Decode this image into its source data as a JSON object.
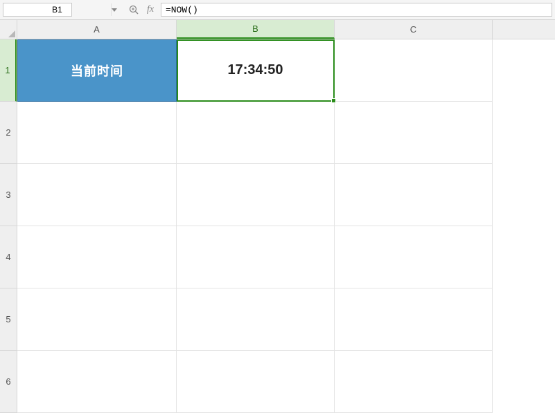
{
  "nameBox": {
    "value": "B1"
  },
  "formulaBar": {
    "value": "=NOW()"
  },
  "fxLabel": "fx",
  "columns": {
    "A": {
      "label": "A"
    },
    "B": {
      "label": "B"
    },
    "C": {
      "label": "C"
    }
  },
  "rows": {
    "r1": {
      "label": "1"
    },
    "r2": {
      "label": "2"
    },
    "r3": {
      "label": "3"
    },
    "r4": {
      "label": "4"
    },
    "r5": {
      "label": "5"
    },
    "r6": {
      "label": "6"
    }
  },
  "cells": {
    "A1": {
      "value": "当前时间"
    },
    "B1": {
      "value": "17:34:50"
    }
  },
  "selectedCell": "B1"
}
